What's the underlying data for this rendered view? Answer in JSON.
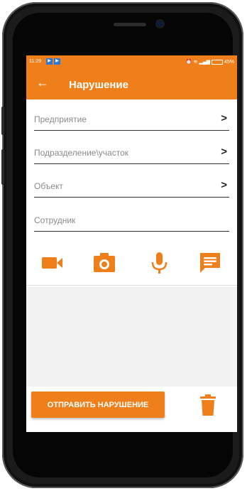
{
  "status_bar": {
    "time": "11:29",
    "battery": "45%",
    "notification_icons": [
      "play-store-icon",
      "play-store-icon"
    ]
  },
  "header": {
    "title": "Нарушение",
    "back_icon": "arrow-left-icon"
  },
  "form": {
    "fields": [
      {
        "label": "Предприятие",
        "has_arrow": true
      },
      {
        "label": "Подразделение\\участок",
        "has_arrow": true
      },
      {
        "label": "Объект",
        "has_arrow": true
      },
      {
        "label": "Сотрудник",
        "has_arrow": false
      }
    ],
    "arrow_glyph": ">"
  },
  "media_buttons": [
    "video-camera-icon",
    "photo-camera-icon",
    "microphone-icon",
    "message-icon"
  ],
  "actions": {
    "send_label": "ОТПРАВИТЬ НАРУШЕНИЕ",
    "delete_icon": "trash-icon"
  },
  "colors": {
    "accent": "#ef7f1a",
    "background": "#f2f2f2"
  }
}
